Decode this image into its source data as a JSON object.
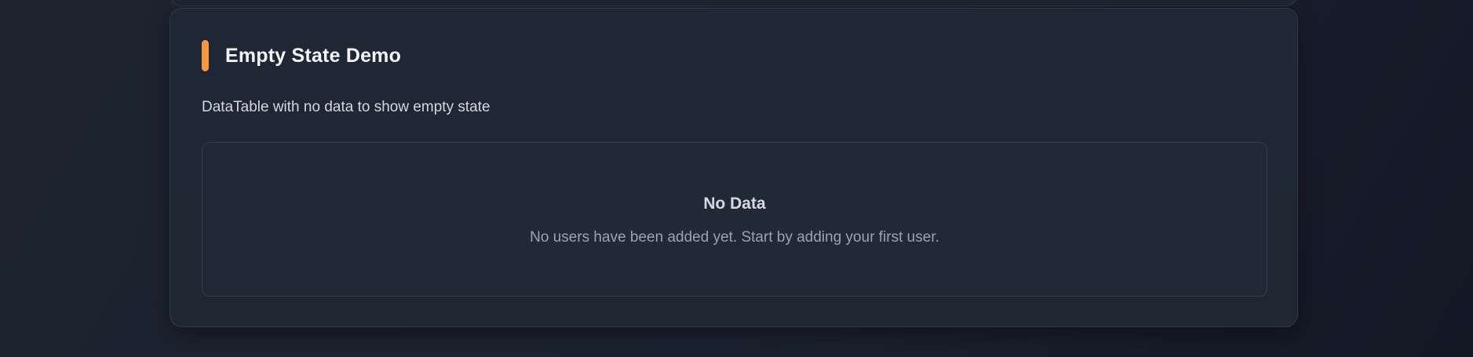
{
  "colors": {
    "accent": "#f79a3e",
    "background": "#1b2230",
    "card": "#202734",
    "border": "#2f3846"
  },
  "section": {
    "title": "Empty State Demo",
    "description": "DataTable with no data to show empty state"
  },
  "empty_state": {
    "title": "No Data",
    "message": "No users have been added yet. Start by adding your first user."
  }
}
